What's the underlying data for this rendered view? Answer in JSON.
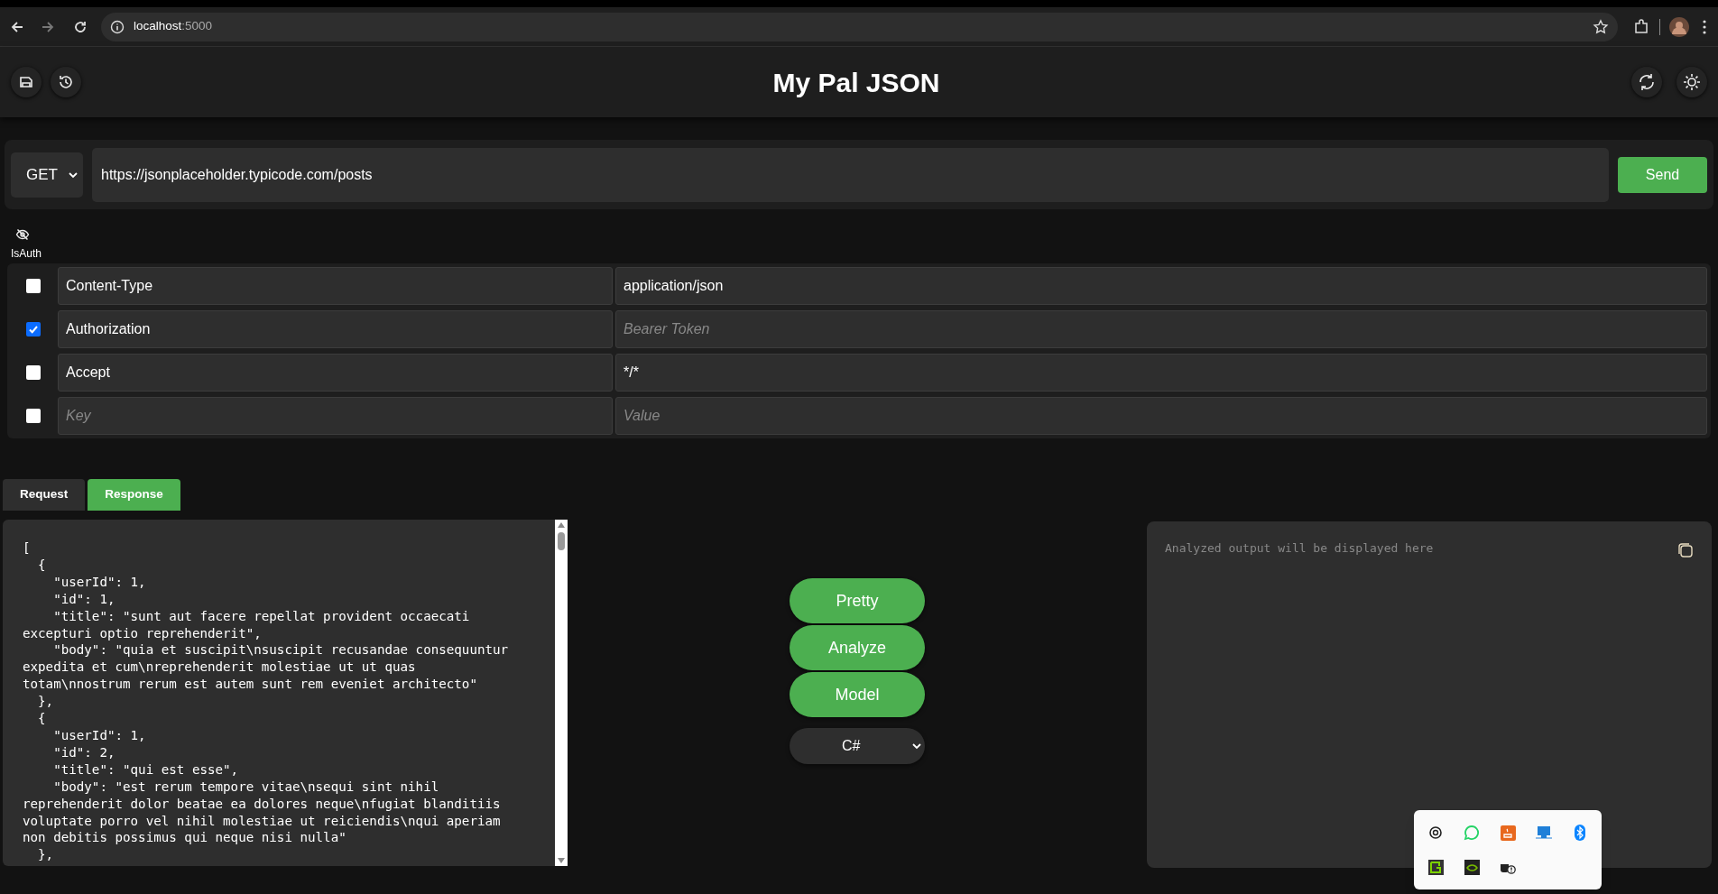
{
  "browser": {
    "host": "localhost",
    "port": ":5000"
  },
  "app": {
    "title": "My Pal JSON"
  },
  "request": {
    "method": "GET",
    "url": "https://jsonplaceholder.typicode.com/posts",
    "send_label": "Send"
  },
  "auth": {
    "label": "IsAuth"
  },
  "headers": [
    {
      "checked": false,
      "key": "Content-Type",
      "value": "application/json"
    },
    {
      "checked": true,
      "key": "Authorization",
      "value_placeholder": "Bearer Token"
    },
    {
      "checked": false,
      "key": "Accept",
      "value": "*/*"
    },
    {
      "checked": false,
      "key_placeholder": "Key",
      "value_placeholder": "Value"
    }
  ],
  "tabs": [
    {
      "label": "Request",
      "selected": false
    },
    {
      "label": "Response",
      "selected": true
    }
  ],
  "response_lines": [
    "[",
    "  {",
    "    \"userId\": 1,",
    "    \"id\": 1,",
    "    \"title\": \"sunt aut facere repellat provident occaecati",
    "excepturi optio reprehenderit\",",
    "    \"body\": \"quia et suscipit\\nsuscipit recusandae consequuntur",
    "expedita et cum\\nreprehenderit molestiae ut ut quas",
    "totam\\nnostrum rerum est autem sunt rem eveniet architecto\"",
    "  },",
    "  {",
    "    \"userId\": 1,",
    "    \"id\": 2,",
    "    \"title\": \"qui est esse\",",
    "    \"body\": \"est rerum tempore vitae\\nsequi sint nihil",
    "reprehenderit dolor beatae ea dolores neque\\nfugiat blanditiis",
    "voluptate porro vel nihil molestiae ut reiciendis\\nqui aperiam",
    "non debitis possimus qui neque nisi nulla\"",
    "  },"
  ],
  "actions": [
    "Pretty",
    "Analyze",
    "Model"
  ],
  "language": "C#",
  "output": {
    "placeholder": "Analyzed output will be displayed here"
  }
}
